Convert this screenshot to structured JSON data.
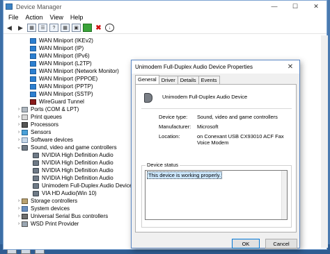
{
  "device_manager": {
    "title": "Device Manager",
    "window_controls": {
      "minimize": "—",
      "maximize": "☐",
      "close": "✕"
    },
    "menu": [
      "File",
      "Action",
      "View",
      "Help"
    ],
    "toolbar_icons": [
      "back-arrow-icon",
      "forward-arrow-icon",
      "properties-icon",
      "list-icon",
      "help-icon",
      "grid-icon",
      "scan-monitor-icon",
      "add-driver-icon",
      "remove-device-icon",
      "download-icon"
    ],
    "tree": [
      {
        "label": "WAN Miniport (IKEv2)",
        "level": 2,
        "icon": "network-adapter-icon"
      },
      {
        "label": "WAN Miniport (IP)",
        "level": 2,
        "icon": "network-adapter-icon"
      },
      {
        "label": "WAN Miniport (IPv6)",
        "level": 2,
        "icon": "network-adapter-icon"
      },
      {
        "label": "WAN Miniport (L2TP)",
        "level": 2,
        "icon": "network-adapter-icon"
      },
      {
        "label": "WAN Miniport (Network Monitor)",
        "level": 2,
        "icon": "network-adapter-icon"
      },
      {
        "label": "WAN Miniport (PPPOE)",
        "level": 2,
        "icon": "network-adapter-icon"
      },
      {
        "label": "WAN Miniport (PPTP)",
        "level": 2,
        "icon": "network-adapter-icon"
      },
      {
        "label": "WAN Miniport (SSTP)",
        "level": 2,
        "icon": "network-adapter-icon"
      },
      {
        "label": "WireGuard Tunnel",
        "level": 2,
        "icon": "wireguard-icon"
      },
      {
        "label": "Ports (COM & LPT)",
        "level": 1,
        "icon": "ports-icon",
        "expander": "›"
      },
      {
        "label": "Print queues",
        "level": 1,
        "icon": "print-queue-icon",
        "expander": "›"
      },
      {
        "label": "Processors",
        "level": 1,
        "icon": "processor-icon",
        "expander": "›"
      },
      {
        "label": "Sensors",
        "level": 1,
        "icon": "sensor-icon",
        "expander": "›"
      },
      {
        "label": "Software devices",
        "level": 1,
        "icon": "software-device-icon",
        "expander": "›"
      },
      {
        "label": "Sound, video and game controllers",
        "level": 1,
        "icon": "sound-controller-icon",
        "expander": "⌄"
      },
      {
        "label": "NVIDIA High Definition Audio",
        "level": 2,
        "icon": "speaker-icon"
      },
      {
        "label": "NVIDIA High Definition Audio",
        "level": 2,
        "icon": "speaker-icon"
      },
      {
        "label": "NVIDIA High Definition Audio",
        "level": 2,
        "icon": "speaker-icon"
      },
      {
        "label": "NVIDIA High Definition Audio",
        "level": 2,
        "icon": "speaker-icon"
      },
      {
        "label": "Unimodem Full-Duplex Audio Device",
        "level": 2,
        "icon": "speaker-icon"
      },
      {
        "label": "VIA HD Audio(Win 10)",
        "level": 2,
        "icon": "speaker-icon"
      },
      {
        "label": "Storage controllers",
        "level": 1,
        "icon": "storage-controller-icon",
        "expander": "›"
      },
      {
        "label": "System devices",
        "level": 1,
        "icon": "system-device-icon",
        "expander": "›"
      },
      {
        "label": "Universal Serial Bus controllers",
        "level": 1,
        "icon": "usb-controller-icon",
        "expander": "›"
      },
      {
        "label": "WSD Print Provider",
        "level": 1,
        "icon": "wsd-print-icon",
        "expander": "›"
      }
    ]
  },
  "properties_dialog": {
    "title": "Unimodem Full-Duplex Audio Device Properties",
    "close": "✕",
    "tabs": [
      "General",
      "Driver",
      "Details",
      "Events"
    ],
    "active_tab": "General",
    "device_name": "Unimodem Full-Duplex Audio Device",
    "props": {
      "device_type_label": "Device type:",
      "device_type_value": "Sound, video and game controllers",
      "manufacturer_label": "Manufacturer:",
      "manufacturer_value": "Microsoft",
      "location_label": "Location:",
      "location_value": "on Conexant USB CX93010 ACF Fax Voice Modem"
    },
    "status_group_label": "Device status",
    "status_text": "This device is working properly.",
    "ok_label": "OK",
    "cancel_label": "Cancel"
  },
  "colors": {
    "accent": "#0078d7",
    "desktop": "#4a7ab0"
  }
}
